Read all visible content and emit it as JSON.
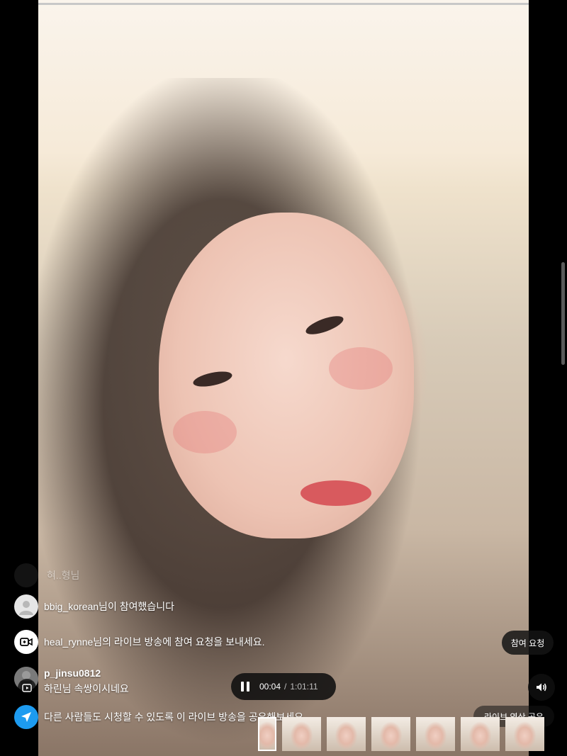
{
  "video": {
    "description_icon": "live-video"
  },
  "chat": {
    "faded_message": "혀..형님",
    "join_message": "bbig_korean님이 참여했습니다",
    "request_message": "heal_rynne님의 라이브 방송에 참여 요청을 보내세요.",
    "comment": {
      "username": "p_jinsu0812",
      "text": "하린님 속쌍이시네요"
    },
    "share_message": "다른 사람들도 시청할 수 있도록 이 라이브 방송을 공유해보세요."
  },
  "buttons": {
    "join_request": "참여 요청",
    "share_live": "라이브 영상 공유"
  },
  "player": {
    "current_time": "00:04",
    "separator": "/",
    "duration": "1:01:11"
  },
  "colors": {
    "share_blue": "#1d9bf0",
    "panel_dark": "#141414"
  }
}
